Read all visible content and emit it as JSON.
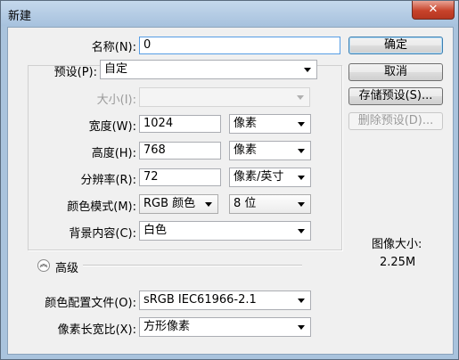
{
  "window": {
    "title": "新建",
    "close_glyph": "✕"
  },
  "form": {
    "name": {
      "label": "名称(N):",
      "value": "0"
    },
    "preset": {
      "label": "预设(P):",
      "value": "自定"
    },
    "size": {
      "label": "大小(I):",
      "value": ""
    },
    "width": {
      "label": "宽度(W):",
      "value": "1024",
      "unit": "像素"
    },
    "height": {
      "label": "高度(H):",
      "value": "768",
      "unit": "像素"
    },
    "resolution": {
      "label": "分辨率(R):",
      "value": "72",
      "unit": "像素/英寸"
    },
    "color_mode": {
      "label": "颜色模式(M):",
      "value": "RGB 颜色",
      "bit_depth": "8 位"
    },
    "background": {
      "label": "背景内容(C):",
      "value": "白色"
    },
    "advanced": {
      "label": "高级",
      "icon": "chevron-double-up-icon",
      "glyph": "︽"
    },
    "color_profile": {
      "label": "颜色配置文件(O):",
      "value": "sRGB IEC61966-2.1"
    },
    "pixel_aspect": {
      "label": "像素长宽比(X):",
      "value": "方形像素"
    }
  },
  "buttons": {
    "ok": "确定",
    "cancel": "取消",
    "save_preset": "存储预设(S)...",
    "delete_preset": "删除预设(D)..."
  },
  "info": {
    "image_size_label": "图像大小:",
    "image_size_value": "2.25M"
  },
  "colors": {
    "titlebar": "#a9c3dd",
    "client": "#f0f0f0",
    "close": "#c7432b",
    "focus_border": "#569de5"
  }
}
